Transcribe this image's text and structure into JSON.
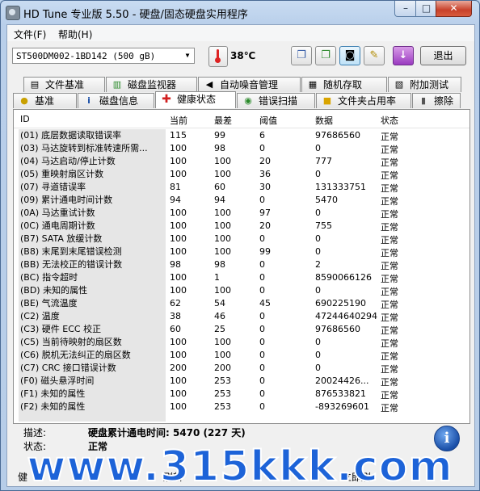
{
  "window": {
    "title": "HD Tune 专业版 5.50 - 硬盘/固态硬盘实用程序",
    "minimize": "–",
    "maximize": "□",
    "close": "✕"
  },
  "menu": {
    "file": "文件(F)",
    "help": "帮助(H)"
  },
  "toolbar": {
    "drive": "ST500DM002-1BD142 (500 gB)",
    "temperature": "38℃",
    "exit_label": "退出"
  },
  "tabs_top": [
    {
      "label": "文件基准",
      "icon": "file-benchmark-icon"
    },
    {
      "label": "磁盘监视器",
      "icon": "disk-monitor-icon"
    },
    {
      "label": "自动噪音管理",
      "icon": "speaker-icon"
    },
    {
      "label": "随机存取",
      "icon": "random-access-icon"
    },
    {
      "label": "附加测试",
      "icon": "extra-tests-icon"
    }
  ],
  "tabs_bottom": [
    {
      "label": "基准",
      "icon": "lightbulb-icon"
    },
    {
      "label": "磁盘信息",
      "icon": "info-icon"
    },
    {
      "label": "健康状态",
      "icon": "health-cross-icon"
    },
    {
      "label": "错误扫描",
      "icon": "error-scan-icon"
    },
    {
      "label": "文件夹占用率",
      "icon": "folder-icon"
    },
    {
      "label": "擦除",
      "icon": "trash-icon"
    }
  ],
  "table": {
    "headers": {
      "id": "ID",
      "current": "当前",
      "worst": "最差",
      "threshold": "阈值",
      "data": "数据",
      "status": "状态"
    },
    "rows": [
      {
        "id": "(01) 底层数据读取错误率",
        "current": "115",
        "worst": "99",
        "threshold": "6",
        "data": "97686560",
        "status": "正常"
      },
      {
        "id": "(03) 马达旋转到标准转速所需...",
        "current": "100",
        "worst": "98",
        "threshold": "0",
        "data": "0",
        "status": "正常"
      },
      {
        "id": "(04) 马达启动/停止计数",
        "current": "100",
        "worst": "100",
        "threshold": "20",
        "data": "777",
        "status": "正常"
      },
      {
        "id": "(05) 重映射扇区计数",
        "current": "100",
        "worst": "100",
        "threshold": "36",
        "data": "0",
        "status": "正常"
      },
      {
        "id": "(07) 寻道错误率",
        "current": "81",
        "worst": "60",
        "threshold": "30",
        "data": "131333751",
        "status": "正常"
      },
      {
        "id": "(09) 累计通电时间计数",
        "current": "94",
        "worst": "94",
        "threshold": "0",
        "data": "5470",
        "status": "正常"
      },
      {
        "id": "(0A) 马达重试计数",
        "current": "100",
        "worst": "100",
        "threshold": "97",
        "data": "0",
        "status": "正常"
      },
      {
        "id": "(0C) 通电周期计数",
        "current": "100",
        "worst": "100",
        "threshold": "20",
        "data": "755",
        "status": "正常"
      },
      {
        "id": "(B7) SATA 放缓计数",
        "current": "100",
        "worst": "100",
        "threshold": "0",
        "data": "0",
        "status": "正常"
      },
      {
        "id": "(B8) 末尾到末尾错误检测",
        "current": "100",
        "worst": "100",
        "threshold": "99",
        "data": "0",
        "status": "正常"
      },
      {
        "id": "(BB) 无法校正的错误计数",
        "current": "98",
        "worst": "98",
        "threshold": "0",
        "data": "2",
        "status": "正常"
      },
      {
        "id": "(BC) 指令超时",
        "current": "100",
        "worst": "1",
        "threshold": "0",
        "data": "8590066126",
        "status": "正常"
      },
      {
        "id": "(BD) 未知的属性",
        "current": "100",
        "worst": "100",
        "threshold": "0",
        "data": "0",
        "status": "正常"
      },
      {
        "id": "(BE) 气流温度",
        "current": "62",
        "worst": "54",
        "threshold": "45",
        "data": "690225190",
        "status": "正常"
      },
      {
        "id": "(C2) 温度",
        "current": "38",
        "worst": "46",
        "threshold": "0",
        "data": "47244640294",
        "status": "正常"
      },
      {
        "id": "(C3) 硬件 ECC 校正",
        "current": "60",
        "worst": "25",
        "threshold": "0",
        "data": "97686560",
        "status": "正常"
      },
      {
        "id": "(C5) 当前待映射的扇区数",
        "current": "100",
        "worst": "100",
        "threshold": "0",
        "data": "0",
        "status": "正常"
      },
      {
        "id": "(C6) 脱机无法纠正的扇区数",
        "current": "100",
        "worst": "100",
        "threshold": "0",
        "data": "0",
        "status": "正常"
      },
      {
        "id": "(C7) CRC 接口错误计数",
        "current": "200",
        "worst": "200",
        "threshold": "0",
        "data": "0",
        "status": "正常"
      },
      {
        "id": "(F0) 磁头悬浮时间",
        "current": "100",
        "worst": "253",
        "threshold": "0",
        "data": "20024426...",
        "status": "正常"
      },
      {
        "id": "(F1) 未知的属性",
        "current": "100",
        "worst": "253",
        "threshold": "0",
        "data": "876533821",
        "status": "正常"
      },
      {
        "id": "(F2) 未知的属性",
        "current": "100",
        "worst": "253",
        "threshold": "0",
        "data": "-893269601",
        "status": "正常"
      }
    ]
  },
  "details": {
    "desc_label": "描述:",
    "desc_value": "硬盘累计通电时间: 5470 (227 天)",
    "status_label": "状态:",
    "status_value": "正常"
  },
  "bottom": {
    "left_text": "健",
    "mid_text": "刷新",
    "right_text": "立即刷"
  },
  "watermark": "www.315kkk.com"
}
